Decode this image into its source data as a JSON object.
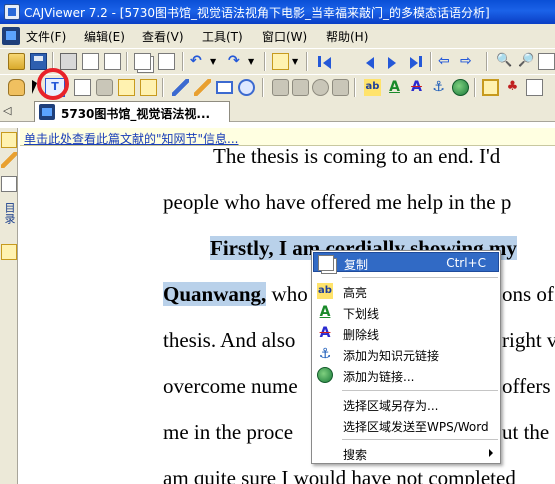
{
  "window": {
    "title": "CAJViewer 7.2 - [5730图书馆_视觉语法视角下电影_当幸福来敲门_的多模态话语分析]"
  },
  "menu": {
    "items": [
      "文件(F)",
      "编辑(E)",
      "查看(V)",
      "工具(T)",
      "窗口(W)",
      "帮助(H)"
    ]
  },
  "tabs": {
    "nav": "◁",
    "active_label": "5730图书馆_视觉语法视..."
  },
  "sidebar": {
    "label": "目录"
  },
  "infobar": {
    "text": "单击此处查看此篇文献的\"知网节\"信息..."
  },
  "document": {
    "lines": [
      {
        "text": "The thesis is coming to an end. I'd"
      },
      {
        "text": "people who have offered me help in the p"
      },
      {
        "parts": [
          "Firstly, I am cordially showing my"
        ]
      },
      {
        "parts": [
          "Quanwang,",
          " who",
          "ons of"
        ]
      },
      {
        "parts": [
          "thesis. And also",
          "right v"
        ]
      },
      {
        "parts": [
          "overcome nume",
          "offers"
        ]
      },
      {
        "parts": [
          "me in the proce",
          "ut the"
        ]
      },
      {
        "text": "am quite sure I would have not completed"
      }
    ]
  },
  "context_menu": {
    "items": [
      {
        "label": "复制",
        "shortcut": "Ctrl+C",
        "icon": "copy-icon"
      },
      {
        "label": "高亮",
        "icon": "highlight-icon"
      },
      {
        "label": "下划线",
        "icon": "underline-icon"
      },
      {
        "label": "删除线",
        "icon": "strikethrough-icon"
      },
      {
        "label": "添加为知识元链接",
        "icon": "anchor-icon"
      },
      {
        "label": "添加为链接...",
        "icon": "globe-link-icon"
      },
      {
        "label": "选择区域另存为..."
      },
      {
        "label": "选择区域发送至WPS/Word"
      },
      {
        "label": "搜索",
        "submenu": true
      }
    ]
  },
  "colors": {
    "title_bar": "#0a4fd6",
    "selection": "#b9d1ea",
    "menu_active": "#316ac5",
    "highlight_ring": "#e8222a"
  }
}
